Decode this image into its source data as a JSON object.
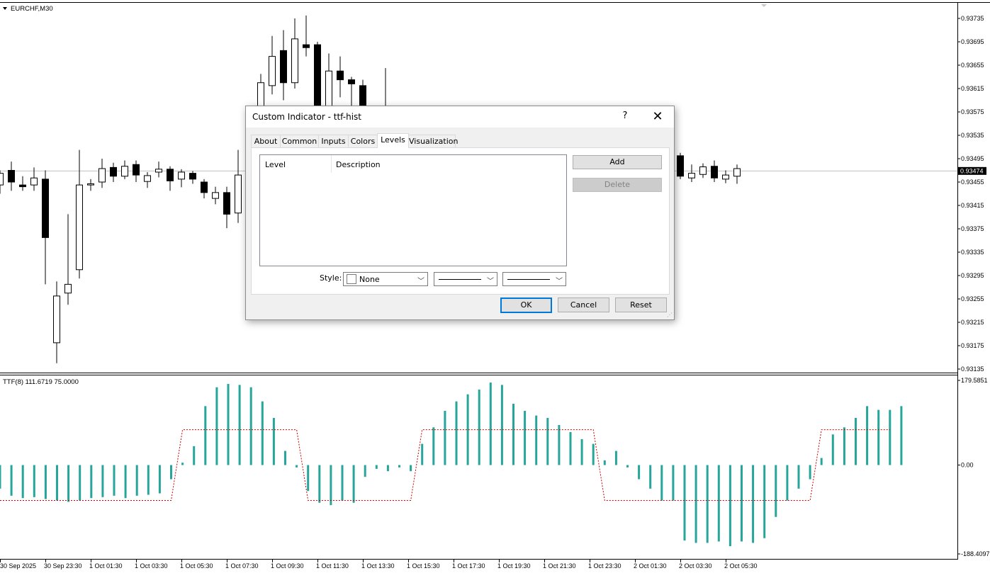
{
  "chart": {
    "symbol_label": "EURCHF,M30",
    "price_axis": [
      "0.93735",
      "0.93695",
      "0.93655",
      "0.93615",
      "0.93575",
      "0.93535",
      "0.93495",
      "0.93455",
      "0.93415",
      "0.93375",
      "0.93335",
      "0.93295",
      "0.93255",
      "0.93215",
      "0.93175",
      "0.93135"
    ],
    "current_price": "0.93474",
    "indicator_label": "TTF(8) 111.6719 75.0000",
    "indicator_axis": [
      "179.5851",
      "0.00",
      "-188.4097"
    ],
    "time_axis": [
      "30 Sep 2025",
      "30 Sep 23:30",
      "1 Oct 01:30",
      "1 Oct 03:30",
      "1 Oct 05:30",
      "1 Oct 07:30",
      "1 Oct 09:30",
      "1 Oct 11:30",
      "1 Oct 13:30",
      "1 Oct 15:30",
      "1 Oct 17:30",
      "1 Oct 19:30",
      "1 Oct 21:30",
      "1 Oct 23:30",
      "2 Oct 01:30",
      "2 Oct 03:30",
      "2 Oct 05:30"
    ],
    "colors": {
      "histogram": "#26a69a",
      "signal_line": "#cc0000",
      "price_line": "#c0c0c0",
      "current_price_bg": "#000000"
    }
  },
  "chart_data": [
    {
      "type": "candlestick",
      "title": "EURCHF,M30",
      "ylim": [
        0.93125,
        0.93755
      ],
      "candles": [
        {
          "o": 0.9345,
          "h": 0.93475,
          "l": 0.93435,
          "c": 0.9347
        },
        {
          "o": 0.93475,
          "h": 0.9349,
          "l": 0.9344,
          "c": 0.93455
        },
        {
          "o": 0.9345,
          "h": 0.93465,
          "l": 0.9344,
          "c": 0.93447
        },
        {
          "o": 0.9345,
          "h": 0.9348,
          "l": 0.9344,
          "c": 0.93462
        },
        {
          "o": 0.9346,
          "h": 0.93475,
          "l": 0.9328,
          "c": 0.9336
        },
        {
          "o": 0.9318,
          "h": 0.93285,
          "l": 0.93145,
          "c": 0.9326
        },
        {
          "o": 0.93265,
          "h": 0.934,
          "l": 0.93245,
          "c": 0.9328
        },
        {
          "o": 0.93305,
          "h": 0.9351,
          "l": 0.9329,
          "c": 0.9345
        },
        {
          "o": 0.9345,
          "h": 0.9346,
          "l": 0.9344,
          "c": 0.93452
        },
        {
          "o": 0.93455,
          "h": 0.93495,
          "l": 0.93445,
          "c": 0.93478
        },
        {
          "o": 0.9348,
          "h": 0.93488,
          "l": 0.93455,
          "c": 0.93465
        },
        {
          "o": 0.93465,
          "h": 0.93492,
          "l": 0.9346,
          "c": 0.93482
        },
        {
          "o": 0.93485,
          "h": 0.93492,
          "l": 0.93455,
          "c": 0.93467
        },
        {
          "o": 0.93456,
          "h": 0.93472,
          "l": 0.93445,
          "c": 0.93466
        },
        {
          "o": 0.93472,
          "h": 0.9349,
          "l": 0.93463,
          "c": 0.93477
        },
        {
          "o": 0.93477,
          "h": 0.93482,
          "l": 0.9344,
          "c": 0.93457
        },
        {
          "o": 0.9346,
          "h": 0.93477,
          "l": 0.93446,
          "c": 0.93472
        },
        {
          "o": 0.9347,
          "h": 0.93474,
          "l": 0.93452,
          "c": 0.9346
        },
        {
          "o": 0.93455,
          "h": 0.9346,
          "l": 0.93427,
          "c": 0.93437
        },
        {
          "o": 0.93427,
          "h": 0.93447,
          "l": 0.93417,
          "c": 0.93437
        },
        {
          "o": 0.93437,
          "h": 0.93447,
          "l": 0.93376,
          "c": 0.934
        },
        {
          "o": 0.93402,
          "h": 0.9351,
          "l": 0.93385,
          "c": 0.93467
        },
        {
          "o": null,
          "h": null,
          "l": null,
          "c": null
        },
        {
          "o": 0.9355,
          "h": 0.9364,
          "l": 0.9354,
          "c": 0.93625
        },
        {
          "o": 0.9362,
          "h": 0.93705,
          "l": 0.93605,
          "c": 0.9367
        },
        {
          "o": 0.9368,
          "h": 0.93715,
          "l": 0.93595,
          "c": 0.93625
        },
        {
          "o": 0.93625,
          "h": 0.93735,
          "l": 0.93615,
          "c": 0.937
        },
        {
          "o": 0.9369,
          "h": 0.9374,
          "l": 0.9367,
          "c": 0.93685
        },
        {
          "o": 0.9369,
          "h": 0.93695,
          "l": 0.9356,
          "c": 0.9358
        },
        {
          "o": 0.9358,
          "h": 0.93675,
          "l": 0.93565,
          "c": 0.93645
        },
        {
          "o": 0.93645,
          "h": 0.9367,
          "l": 0.936,
          "c": 0.9363
        },
        {
          "o": 0.9363,
          "h": 0.93635,
          "l": 0.93585,
          "c": 0.93623
        },
        {
          "o": 0.9362,
          "h": 0.9363,
          "l": 0.9356,
          "c": 0.9358
        },
        {
          "o": 0.9358,
          "h": 0.93585,
          "l": 0.9357,
          "c": 0.93575
        },
        {
          "o": 0.93575,
          "h": 0.9365,
          "l": 0.9356,
          "c": 0.9358
        },
        {
          "o": 0.9358,
          "h": 0.93585,
          "l": 0.9357,
          "c": 0.93575
        },
        {
          "o": null,
          "h": null,
          "l": null,
          "c": null
        },
        {
          "o": null,
          "h": null,
          "l": null,
          "c": null
        },
        {
          "o": null,
          "h": null,
          "l": null,
          "c": null
        },
        {
          "o": null,
          "h": null,
          "l": null,
          "c": null
        },
        {
          "o": null,
          "h": null,
          "l": null,
          "c": null
        },
        {
          "o": null,
          "h": null,
          "l": null,
          "c": null
        },
        {
          "o": null,
          "h": null,
          "l": null,
          "c": null
        },
        {
          "o": null,
          "h": null,
          "l": null,
          "c": null
        },
        {
          "o": null,
          "h": null,
          "l": null,
          "c": null
        },
        {
          "o": null,
          "h": null,
          "l": null,
          "c": null
        },
        {
          "o": null,
          "h": null,
          "l": null,
          "c": null
        },
        {
          "o": null,
          "h": null,
          "l": null,
          "c": null
        },
        {
          "o": null,
          "h": null,
          "l": null,
          "c": null
        },
        {
          "o": null,
          "h": null,
          "l": null,
          "c": null
        },
        {
          "o": null,
          "h": null,
          "l": null,
          "c": null
        },
        {
          "o": null,
          "h": null,
          "l": null,
          "c": null
        },
        {
          "o": null,
          "h": null,
          "l": null,
          "c": null
        },
        {
          "o": null,
          "h": null,
          "l": null,
          "c": null
        },
        {
          "o": null,
          "h": null,
          "l": null,
          "c": null
        },
        {
          "o": null,
          "h": null,
          "l": null,
          "c": null
        },
        {
          "o": null,
          "h": null,
          "l": null,
          "c": null
        },
        {
          "o": null,
          "h": null,
          "l": null,
          "c": null
        },
        {
          "o": null,
          "h": null,
          "l": null,
          "c": null
        },
        {
          "o": 0.935,
          "h": 0.93515,
          "l": 0.9348,
          "c": 0.93503
        },
        {
          "o": 0.935,
          "h": 0.93505,
          "l": 0.9346,
          "c": 0.93465
        },
        {
          "o": 0.93462,
          "h": 0.93485,
          "l": 0.93455,
          "c": 0.9347
        },
        {
          "o": 0.93468,
          "h": 0.93487,
          "l": 0.93462,
          "c": 0.93481
        },
        {
          "o": 0.93482,
          "h": 0.93492,
          "l": 0.93455,
          "c": 0.93462
        },
        {
          "o": 0.9346,
          "h": 0.93475,
          "l": 0.93453,
          "c": 0.93467
        },
        {
          "o": 0.93465,
          "h": 0.93485,
          "l": 0.93452,
          "c": 0.93478
        }
      ],
      "current_price": 0.93474
    },
    {
      "type": "bar",
      "title": "TTF(8) 111.6719 75.0000",
      "ylim": [
        -188.4097,
        179.5851
      ],
      "values": [
        -50,
        -65,
        -70,
        -68,
        -72,
        -75,
        -78,
        -75,
        -70,
        -68,
        -65,
        -70,
        -65,
        -63,
        -60,
        -30,
        5,
        40,
        125,
        165,
        172,
        170,
        165,
        135,
        100,
        30,
        -5,
        -55,
        -80,
        -85,
        -75,
        -80,
        -25,
        -8,
        -13,
        -5,
        -13,
        45,
        80,
        115,
        135,
        150,
        160,
        175,
        170,
        130,
        115,
        105,
        100,
        85,
        70,
        55,
        45,
        10,
        30,
        -5,
        -30,
        -50,
        -75,
        -75,
        -160,
        -165,
        -165,
        -162,
        -172,
        -162,
        -165,
        -155,
        -110,
        -75,
        -50,
        -30,
        15,
        65,
        80,
        100,
        125,
        117,
        117,
        125
      ],
      "signal": [
        -75,
        -75,
        -75,
        -75,
        -75,
        -75,
        -75,
        -75,
        -75,
        -75,
        -75,
        -75,
        -75,
        -75,
        -75,
        -75,
        75,
        75,
        75,
        75,
        75,
        75,
        75,
        75,
        75,
        75,
        75,
        -75,
        -75,
        -75,
        -75,
        -75,
        -75,
        -75,
        -75,
        -75,
        -75,
        75,
        75,
        75,
        75,
        75,
        75,
        75,
        75,
        75,
        75,
        75,
        75,
        75,
        75,
        75,
        75,
        -75,
        -75,
        -75,
        -75,
        -75,
        -75,
        -75,
        -75,
        -75,
        -75,
        -75,
        -75,
        -75,
        -75,
        -75,
        -75,
        -75,
        -75,
        -75,
        75,
        75,
        75,
        75,
        75,
        75,
        75
      ]
    }
  ],
  "dialog": {
    "title": "Custom Indicator - ttf-hist",
    "help": "?",
    "close": "✕",
    "tabs": [
      "About",
      "Common",
      "Inputs",
      "Colors",
      "Levels",
      "Visualization"
    ],
    "active_tab": "Levels",
    "levels_table": {
      "col_level": "Level",
      "col_description": "Description",
      "rows": []
    },
    "add_label": "Add",
    "delete_label": "Delete",
    "style_label": "Style:",
    "style_color_value": "None",
    "ok_label": "OK",
    "cancel_label": "Cancel",
    "reset_label": "Reset"
  }
}
